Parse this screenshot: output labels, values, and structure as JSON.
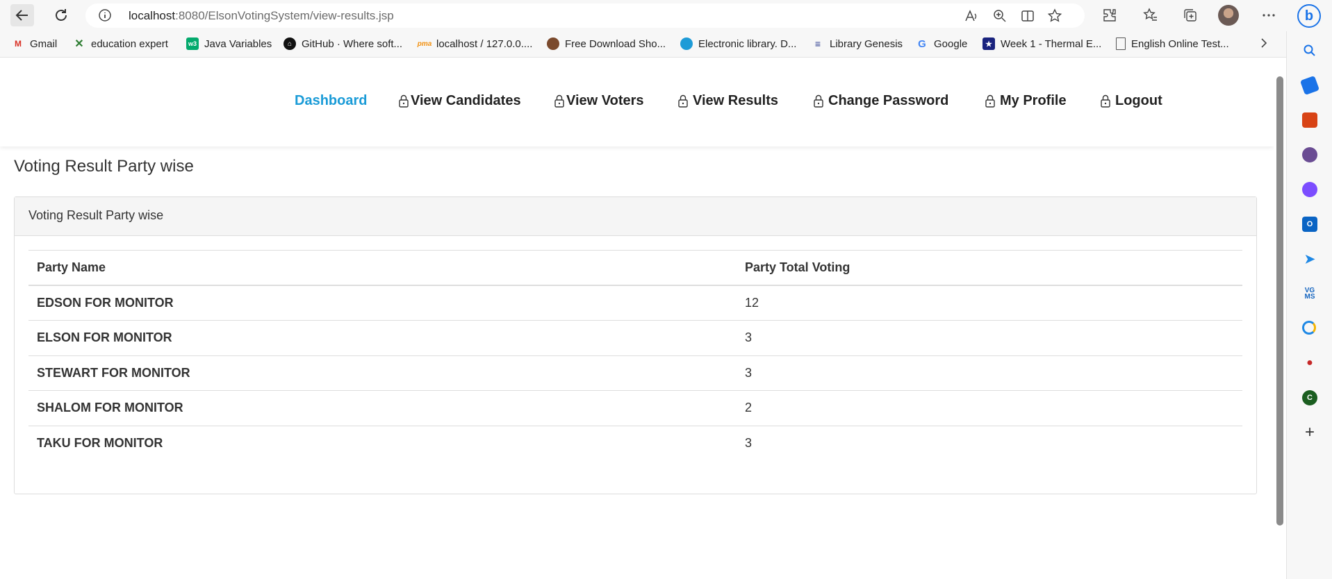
{
  "browser": {
    "url_host": "localhost",
    "url_path": ":8080/ElsonVotingSystem/view-results.jsp"
  },
  "bookmarks": [
    {
      "label": "Gmail",
      "icon": "gmail-icon",
      "color": "#d93025"
    },
    {
      "label": "education expert",
      "icon": "education-expert-icon",
      "color": "#2e7d32"
    },
    {
      "label": "Java Variables",
      "icon": "w3schools-icon",
      "color": "#04aa6d"
    },
    {
      "label": "GitHub · Where soft...",
      "icon": "github-icon",
      "color": "#111111"
    },
    {
      "label": "localhost / 127.0.0....",
      "icon": "phpmyadmin-icon",
      "color": "#f29111"
    },
    {
      "label": "Free Download Sho...",
      "icon": "free-download-icon",
      "color": "#7b4a2d"
    },
    {
      "label": "Electronic library. D...",
      "icon": "electronic-library-icon",
      "color": "#1e9bd7"
    },
    {
      "label": "Library Genesis",
      "icon": "library-genesis-icon",
      "color": "#2b3b8f"
    },
    {
      "label": "Google",
      "icon": "google-icon",
      "color": "#4285f4"
    },
    {
      "label": "Week 1 - Thermal E...",
      "icon": "star-badge-icon",
      "color": "#1a237e"
    },
    {
      "label": "English Online Test...",
      "icon": "page-icon",
      "color": "#555555"
    }
  ],
  "nav": {
    "dashboard": "Dashboard",
    "view_candidates": "View Candidates",
    "view_voters": "View Voters",
    "view_results": "View Results",
    "change_password": "Change Password",
    "my_profile": "My Profile",
    "logout": "Logout",
    "active_color": "#1a9bd7"
  },
  "page": {
    "title": "Voting Result Party wise",
    "panel_heading": "Voting Result Party wise"
  },
  "table": {
    "headers": [
      "Party Name",
      "Party Total Voting"
    ],
    "rows": [
      {
        "party": "EDSON FOR MONITOR",
        "votes": "12"
      },
      {
        "party": "ELSON FOR MONITOR",
        "votes": "3"
      },
      {
        "party": "STEWART FOR MONITOR",
        "votes": "3"
      },
      {
        "party": "SHALOM FOR MONITOR",
        "votes": "2"
      },
      {
        "party": "TAKU FOR MONITOR",
        "votes": "3"
      }
    ]
  },
  "sidebar_icons": [
    "search-icon",
    "tag-icon",
    "briefcase-icon",
    "games-icon",
    "copilot-icon",
    "outlook-icon",
    "send-icon",
    "vgms-icon",
    "extension-icon",
    "university-icon",
    "c-app-icon",
    "add-icon"
  ]
}
